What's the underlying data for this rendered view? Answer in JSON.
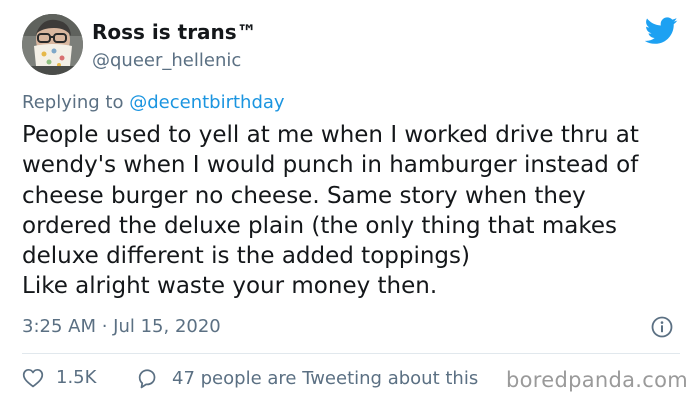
{
  "tweet": {
    "author": {
      "display_name": "Ross is trans™",
      "handle": "@queer_hellenic"
    },
    "reply": {
      "prefix": "Replying to",
      "mention": "@decentbirthday"
    },
    "text_lines": [
      "People used to yell at me when I worked drive thru at",
      "wendy's when I would punch in hamburger instead of",
      "cheese burger no cheese. Same story when they",
      "ordered the deluxe plain (the only thing that makes",
      "deluxe different is the added toppings)",
      "Like alright waste your money then."
    ],
    "timestamp": "3:25 AM · Jul 15, 2020",
    "likes_count": "1.5K",
    "retweeters_text": "47 people are Tweeting about this"
  },
  "icons": {
    "brand": "twitter-bird-icon",
    "info": "info-icon",
    "like": "heart-icon",
    "reply": "speech-bubble-icon"
  },
  "colors": {
    "twitter_blue": "#1da1f2",
    "mention_blue": "#1b95e0",
    "text_primary": "#14171a",
    "text_secondary": "#5b7083",
    "divider": "#e1e8ed",
    "watermark": "#9a9a9a"
  },
  "watermark": "boredpanda.com"
}
